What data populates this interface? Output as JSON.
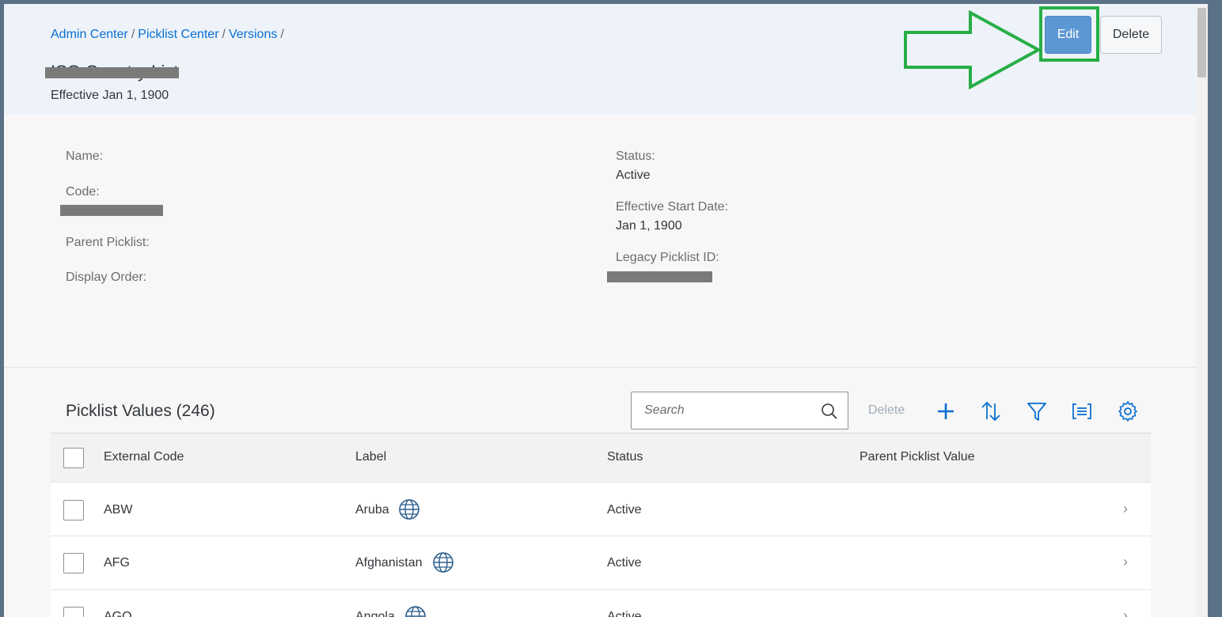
{
  "breadcrumb": {
    "items": [
      "Admin Center",
      "Picklist Center",
      "Versions"
    ],
    "separator": "/"
  },
  "header": {
    "title": "ISO Country List",
    "subtitle": "Effective Jan 1, 1900",
    "edit_label": "Edit",
    "delete_label": "Delete"
  },
  "details": {
    "name_label": "Name:",
    "code_label": "Code:",
    "parent_label": "Parent Picklist:",
    "order_label": "Display Order:",
    "status_label": "Status:",
    "status_value": "Active",
    "start_label": "Effective Start Date:",
    "start_value": "Jan 1, 1900",
    "legacy_label": "Legacy Picklist ID:"
  },
  "table": {
    "title": "Picklist Values (246)",
    "search_placeholder": "Search",
    "delete_label": "Delete",
    "columns": [
      "External Code",
      "Label",
      "Status",
      "Parent Picklist Value"
    ],
    "rows": [
      {
        "code": "ABW",
        "label": "Aruba",
        "status": "Active"
      },
      {
        "code": "AFG",
        "label": "Afghanistan",
        "status": "Active"
      },
      {
        "code": "AGO",
        "label": "Angola",
        "status": "Active"
      }
    ]
  },
  "colors": {
    "accent": "#0a6ed1",
    "edit_button": "#5c97d4",
    "highlight": "#27ae46"
  },
  "icons": [
    "search-icon",
    "add-icon",
    "sort-icon",
    "filter-icon",
    "group-icon",
    "settings-icon",
    "globe-icon",
    "chevron-right-icon"
  ]
}
